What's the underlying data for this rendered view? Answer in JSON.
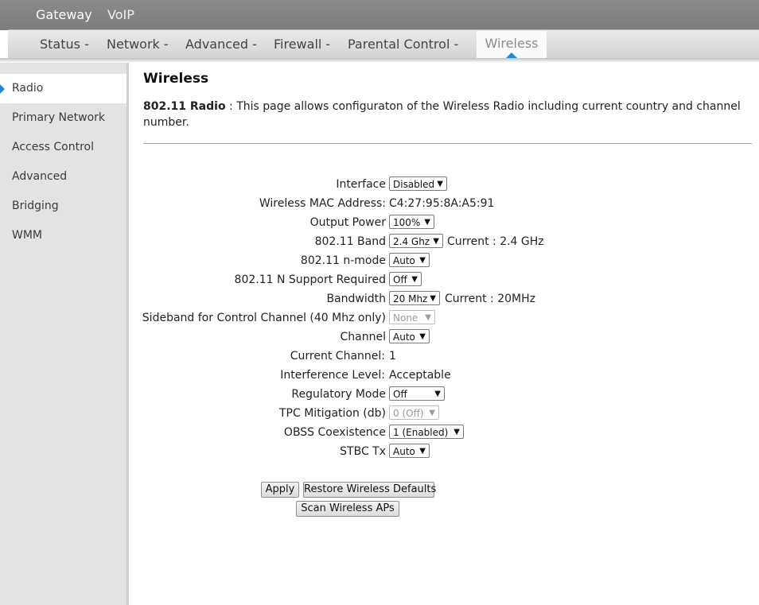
{
  "top_tabs": [
    "Gateway",
    "VoIP"
  ],
  "menu": {
    "items": [
      "Status -",
      "Network -",
      "Advanced -",
      "Firewall -",
      "Parental Control -"
    ],
    "active": "Wireless"
  },
  "sidebar": {
    "items": [
      "Radio",
      "Primary Network",
      "Access Control",
      "Advanced",
      "Bridging",
      "WMM"
    ],
    "active_index": 0
  },
  "page": {
    "title": "Wireless",
    "desc_bold": "802.11 Radio",
    "desc_text": " :  This page allows configuraton of the Wireless Radio including current country and channel number."
  },
  "fields": {
    "interface": {
      "label": "Interface",
      "value": "Disabled"
    },
    "mac": {
      "label": "Wireless MAC Address:",
      "value": "C4:27:95:8A:A5:91"
    },
    "output_power": {
      "label": "Output Power",
      "value": "100%"
    },
    "band": {
      "label": "802.11 Band",
      "value": "2.4 Ghz",
      "current": "Current :  2.4 GHz"
    },
    "nmode": {
      "label": "802.11 n-mode",
      "value": "Auto"
    },
    "nsupport": {
      "label": "802.11 N Support Required",
      "value": "Off"
    },
    "bandwidth": {
      "label": "Bandwidth",
      "value": "20 Mhz",
      "current": "Current :  20MHz"
    },
    "sideband": {
      "label": "Sideband for Control Channel (40 Mhz only)",
      "value": "None"
    },
    "channel": {
      "label": "Channel",
      "value": "Auto"
    },
    "current_channel": {
      "label": "Current Channel:",
      "value": "1"
    },
    "interference": {
      "label": "Interference Level:",
      "value": "Acceptable"
    },
    "regulatory": {
      "label": "Regulatory Mode",
      "value": "Off"
    },
    "tpc": {
      "label": "TPC Mitigation (db)",
      "value": "0 (Off)"
    },
    "obss": {
      "label": "OBSS Coexistence",
      "value": "1 (Enabled)"
    },
    "stbc": {
      "label": "STBC Tx",
      "value": "Auto"
    }
  },
  "buttons": {
    "apply": "Apply",
    "restore": "Restore Wireless Defaults",
    "scan": "Scan Wireless APs"
  },
  "colors": {
    "accent": "#1a8be0",
    "topbar": "#828282",
    "sidebar": "#e3e3e3"
  }
}
